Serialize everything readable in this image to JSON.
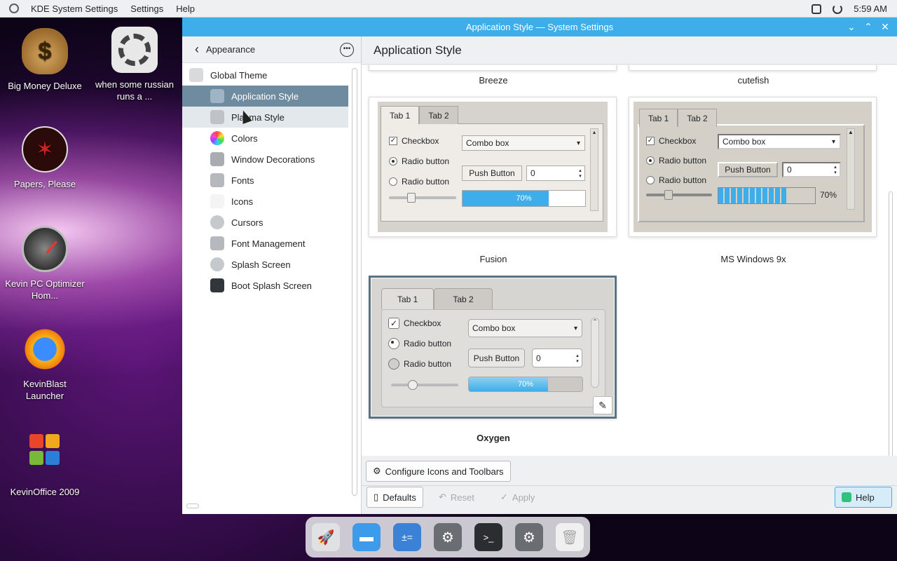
{
  "topbar": {
    "menus": [
      "KDE System Settings",
      "Settings",
      "Help"
    ],
    "time": "5:59 AM"
  },
  "desktop_icons": [
    {
      "label": "Big Money Deluxe",
      "icon": "money-bag-icon"
    },
    {
      "label": "when some russian runs a ...",
      "icon": "gear-icon"
    },
    {
      "label": "Papers, Please",
      "icon": "papers-please-icon"
    },
    {
      "label": "Kevin PC Optimizer Hom...",
      "icon": "speedometer-icon"
    },
    {
      "label": "KevinBlast Launcher",
      "icon": "blast-icon"
    },
    {
      "label": "KevinOffice 2009",
      "icon": "office-icon"
    }
  ],
  "window": {
    "title": "Application Style — System Settings"
  },
  "sidebar": {
    "header": "Appearance",
    "items": [
      {
        "label": "Global Theme",
        "color": "#d8dadc"
      },
      {
        "label": "Application Style",
        "color": "#9fb5c6"
      },
      {
        "label": "Plasma Style",
        "color": "#bfc3c7"
      },
      {
        "label": "Colors",
        "color": "#e86fd4"
      },
      {
        "label": "Window Decorations",
        "color": "#a9adb1"
      },
      {
        "label": "Fonts",
        "color": "#b5b9bd"
      },
      {
        "label": "Icons",
        "color": "#f4f4f4"
      },
      {
        "label": "Cursors",
        "color": "#c6c9cc"
      },
      {
        "label": "Font Management",
        "color": "#b5b9bd"
      },
      {
        "label": "Splash Screen",
        "color": "#c6c9cc"
      },
      {
        "label": "Boot Splash Screen",
        "color": "#31363b"
      }
    ]
  },
  "main": {
    "title": "Application Style",
    "styles": [
      {
        "name": "Breeze"
      },
      {
        "name": "cutefish"
      },
      {
        "name": "Fusion"
      },
      {
        "name": "MS Windows 9x"
      },
      {
        "name": "Oxygen"
      }
    ],
    "preview": {
      "tab1": "Tab 1",
      "tab2": "Tab 2",
      "checkbox": "Checkbox",
      "radio": "Radio button",
      "combo": "Combo box",
      "push": "Push Button",
      "spin": "0",
      "progress_label": "70%",
      "progress": 0.7
    },
    "configure_button": "Configure Icons and Toolbars"
  },
  "footer": {
    "defaults": "Defaults",
    "reset": "Reset",
    "apply": "Apply",
    "help": "Help"
  },
  "colors": {
    "accent": "#3daee9",
    "selection": "#6e8ba0"
  },
  "dock": [
    "rocket-icon",
    "folder-icon",
    "calculator-icon",
    "settings-icon",
    "terminal-icon",
    "system-settings-icon",
    "trash-icon"
  ]
}
